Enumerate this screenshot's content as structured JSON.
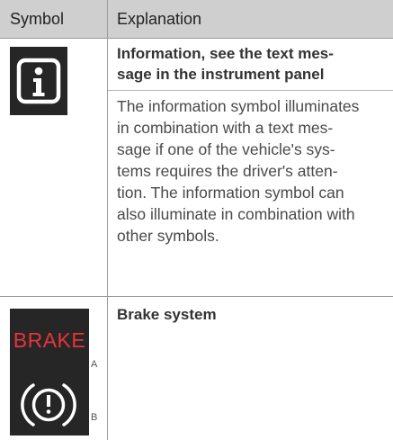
{
  "header": {
    "symbol": "Symbol",
    "explanation": "Explanation"
  },
  "rows": [
    {
      "icon": "information-icon",
      "title_lines": [
        "Information, see the text mes-",
        "sage in the instrument panel"
      ],
      "body_lines": [
        "The information symbol illuminates",
        "in combination with a text mes-",
        "sage if one of the vehicle's sys-",
        "tems requires the driver's atten-",
        "tion. The information symbol can",
        "also illuminate in combination with",
        "other symbols."
      ]
    },
    {
      "icon": "brake-system-icon",
      "title_lines": [
        "Brake system"
      ],
      "variant_a": {
        "label": "BRAKE",
        "footnote": "A"
      },
      "variant_b": {
        "footnote": "B"
      }
    }
  ],
  "colors": {
    "header_bg": "#cfcfcf",
    "symbol_bg": "#262626",
    "brake_text": "#e8333c",
    "icon_stroke": "#ffffff"
  }
}
